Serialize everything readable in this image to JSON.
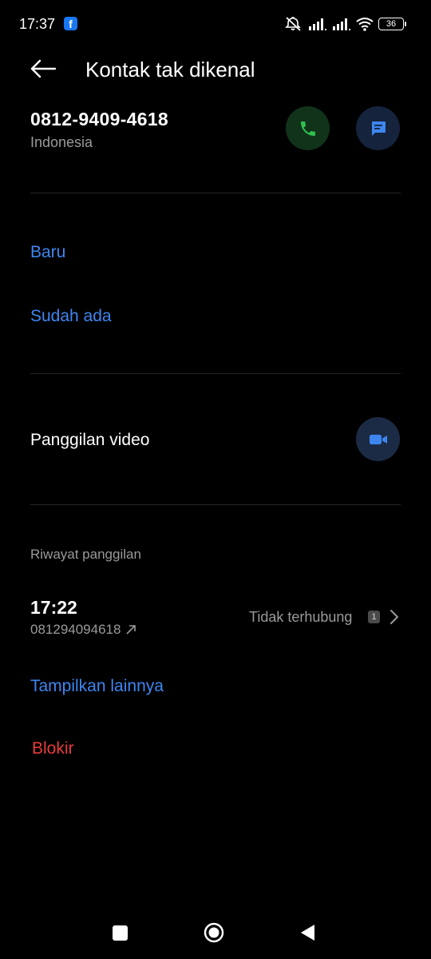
{
  "status_bar": {
    "time": "17:37",
    "battery": "36",
    "icons": [
      "facebook-icon",
      "mute-icon",
      "signal-icon",
      "signal-icon",
      "wifi-icon",
      "battery-icon"
    ]
  },
  "header": {
    "title": "Kontak tak dikenal",
    "back_icon": "arrow-left-icon"
  },
  "contact": {
    "number": "0812-9409-4618",
    "country": "Indonesia",
    "call_icon": "phone-icon",
    "message_icon": "message-icon"
  },
  "add_contact": {
    "new_label": "Baru",
    "existing_label": "Sudah ada"
  },
  "video": {
    "label": "Panggilan video",
    "icon": "video-camera-icon"
  },
  "call_history": {
    "section_label": "Riwayat panggilan",
    "entries": [
      {
        "time": "17:22",
        "number": "081294094618",
        "direction_icon": "outgoing-arrow-icon",
        "status": "Tidak terhubung",
        "sim": "1"
      }
    ],
    "show_more_label": "Tampilkan lainnya"
  },
  "block_label": "Blokir",
  "colors": {
    "accent": "#3d86f0",
    "danger": "#e83a3a",
    "call_green": "#2fbf4f",
    "background": "#000000"
  },
  "nav": [
    "recents-square-icon",
    "home-circle-icon",
    "back-triangle-icon"
  ]
}
